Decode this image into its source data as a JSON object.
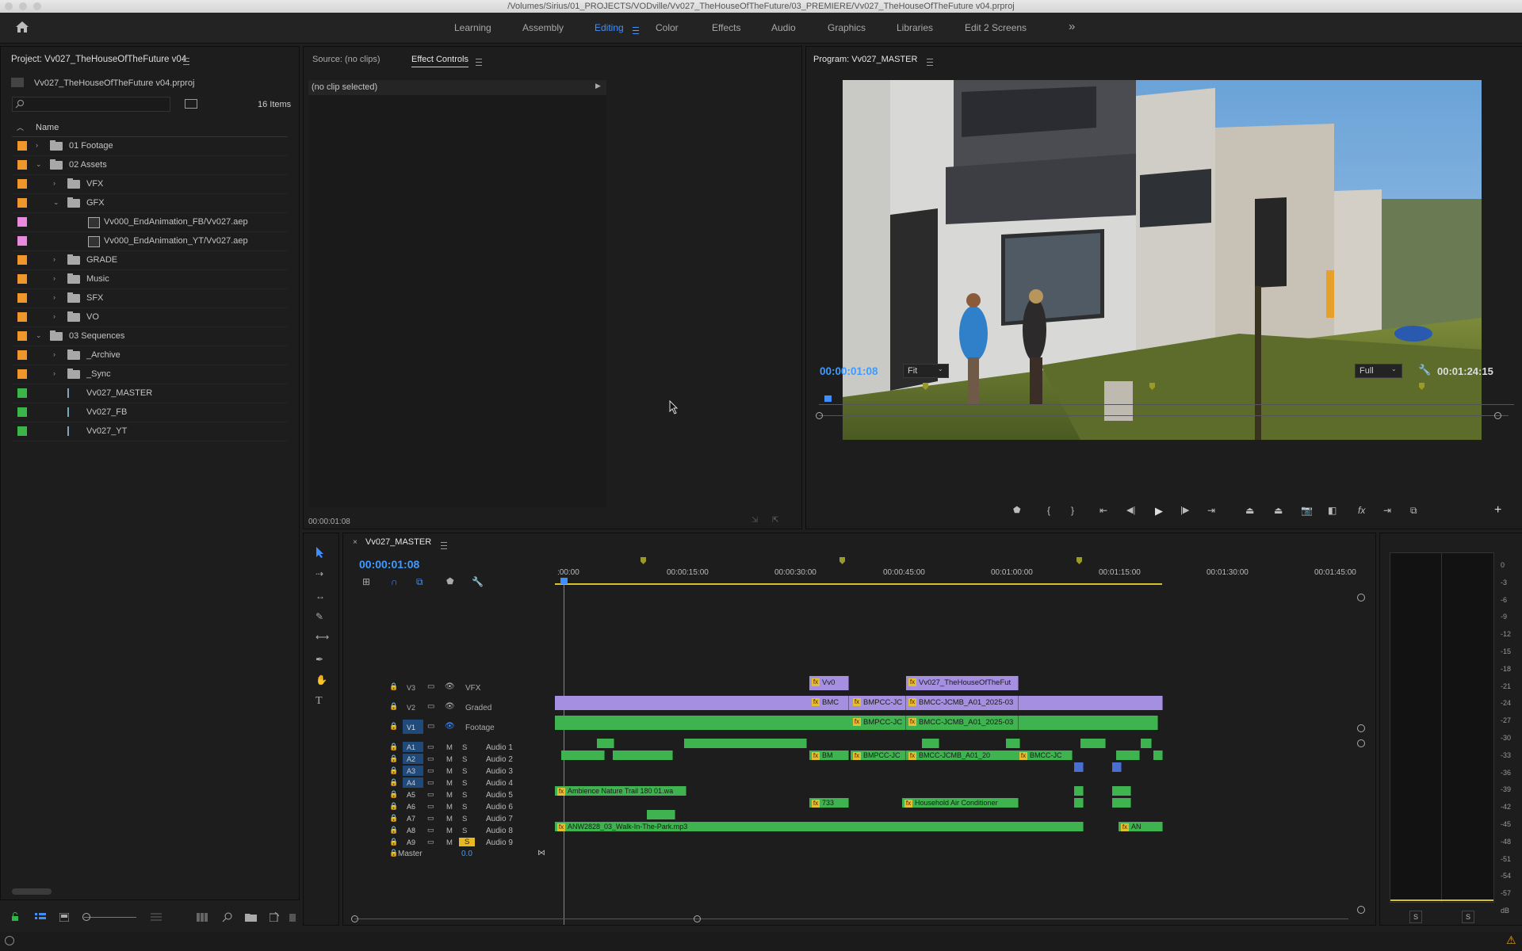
{
  "window": {
    "title": "/Volumes/Sirius/01_PROJECTS/VODville/Vv027_TheHouseOfTheFuture/03_PREMIERE/Vv027_TheHouseOfTheFuture v04.prproj"
  },
  "workspaces": {
    "tabs": [
      "Learning",
      "Assembly",
      "Editing",
      "Color",
      "Effects",
      "Audio",
      "Graphics",
      "Libraries",
      "Edit 2 Screens"
    ],
    "active": "Editing",
    "more": "»"
  },
  "project": {
    "title": "Project: Vv027_TheHouseOfTheFuture v04",
    "file": "Vv027_TheHouseOfTheFuture v04.prproj",
    "search_placeholder": "",
    "item_count": "16 Items",
    "column_name": "Name",
    "items": [
      {
        "label": "01 Footage",
        "kind": "folder",
        "indent": 0,
        "expanded": false,
        "color": "#f0962a"
      },
      {
        "label": "02 Assets",
        "kind": "folder",
        "indent": 0,
        "expanded": true,
        "color": "#f0962a"
      },
      {
        "label": "VFX",
        "kind": "folder",
        "indent": 1,
        "expanded": false,
        "color": "#f0962a"
      },
      {
        "label": "GFX",
        "kind": "folder",
        "indent": 1,
        "expanded": true,
        "color": "#f0962a"
      },
      {
        "label": "Vv000_EndAnimation_FB/Vv027.aep",
        "kind": "ae",
        "indent": 2,
        "color": "#e98ae0"
      },
      {
        "label": "Vv000_EndAnimation_YT/Vv027.aep",
        "kind": "ae",
        "indent": 2,
        "color": "#e98ae0"
      },
      {
        "label": "GRADE",
        "kind": "folder",
        "indent": 1,
        "expanded": false,
        "color": "#f0962a"
      },
      {
        "label": "Music",
        "kind": "folder",
        "indent": 1,
        "expanded": false,
        "color": "#f0962a"
      },
      {
        "label": "SFX",
        "kind": "folder",
        "indent": 1,
        "expanded": false,
        "color": "#f0962a"
      },
      {
        "label": "VO",
        "kind": "folder",
        "indent": 1,
        "expanded": false,
        "color": "#f0962a"
      },
      {
        "label": "03 Sequences",
        "kind": "folder",
        "indent": 0,
        "expanded": true,
        "color": "#f0962a"
      },
      {
        "label": "_Archive",
        "kind": "folder",
        "indent": 1,
        "expanded": false,
        "color": "#f0962a"
      },
      {
        "label": "_Sync",
        "kind": "folder",
        "indent": 1,
        "expanded": false,
        "color": "#f0962a"
      },
      {
        "label": "Vv027_MASTER",
        "kind": "sequence",
        "indent": 1,
        "color": "#3ab54a"
      },
      {
        "label": "Vv027_FB",
        "kind": "sequence",
        "indent": 1,
        "color": "#3ab54a"
      },
      {
        "label": "Vv027_YT",
        "kind": "sequence",
        "indent": 1,
        "color": "#3ab54a"
      }
    ]
  },
  "source": {
    "tab_source": "Source: (no clips)",
    "tab_effects": "Effect Controls",
    "no_clip": "(no clip selected)",
    "timecode": "00:00:01:08"
  },
  "program": {
    "title": "Program: Vv027_MASTER",
    "timecode": "00:00:01:08",
    "fit": "Fit",
    "resolution": "Full",
    "duration": "00:01:24:15"
  },
  "timeline": {
    "tab": "Vv027_MASTER",
    "timecode": "00:00:01:08",
    "ruler": [
      ":00:00",
      "00:00:15:00",
      "00:00:30:00",
      "00:00:45:00",
      "00:01:00:00",
      "00:01:15:00",
      "00:01:30:00",
      "00:01:45:00"
    ],
    "video_tracks": [
      {
        "id": "V3",
        "name": "VFX"
      },
      {
        "id": "V2",
        "name": "Graded"
      },
      {
        "id": "V1",
        "name": "Footage"
      }
    ],
    "audio_tracks": [
      {
        "id": "A1",
        "name": "Audio 1"
      },
      {
        "id": "A2",
        "name": "Audio 2"
      },
      {
        "id": "A3",
        "name": "Audio 3"
      },
      {
        "id": "A4",
        "name": "Audio 4"
      },
      {
        "id": "A5",
        "name": "Audio 5"
      },
      {
        "id": "A6",
        "name": "Audio 6"
      },
      {
        "id": "A7",
        "name": "Audio 7"
      },
      {
        "id": "A8",
        "name": "Audio 8"
      },
      {
        "id": "A9",
        "name": "Audio 9"
      }
    ],
    "master_label": "Master",
    "master_value": "0.0",
    "clip_labels": {
      "v3_a": "Vv0",
      "v3_b": "Vv027_TheHouseOfTheFut",
      "v2_a": "BMC",
      "v2_b": "BMPCC-JC",
      "v2_c": "BMCC-JCMB_A01_2025-03",
      "v1_b": "BMPCC-JC",
      "v1_c": "BMCC-JCMB_A01_2025-03",
      "a2_a": "BM",
      "a2_b": "BMPCC-JC",
      "a2_c": "BMCC-JCMB_A01_20",
      "a2_d": "BMCC-JC",
      "a5": "Ambience Nature Trail 180 01.wa",
      "a6_a": "733",
      "a6_b": "Household Air Conditioner",
      "a8_a": "ANW2828_03_Walk-In-The-Park.mp3",
      "a8_b": "AN"
    },
    "mute": "M",
    "solo": "S",
    "fx": "fx"
  },
  "meter": {
    "scale": [
      "0",
      "-3",
      "-6",
      "-9",
      "-12",
      "-15",
      "-18",
      "-21",
      "-24",
      "-27",
      "-30",
      "-33",
      "-36",
      "-39",
      "-42",
      "-45",
      "-48",
      "-51",
      "-54",
      "-57",
      "dB"
    ],
    "solo_left": "S",
    "solo_right": "S"
  }
}
